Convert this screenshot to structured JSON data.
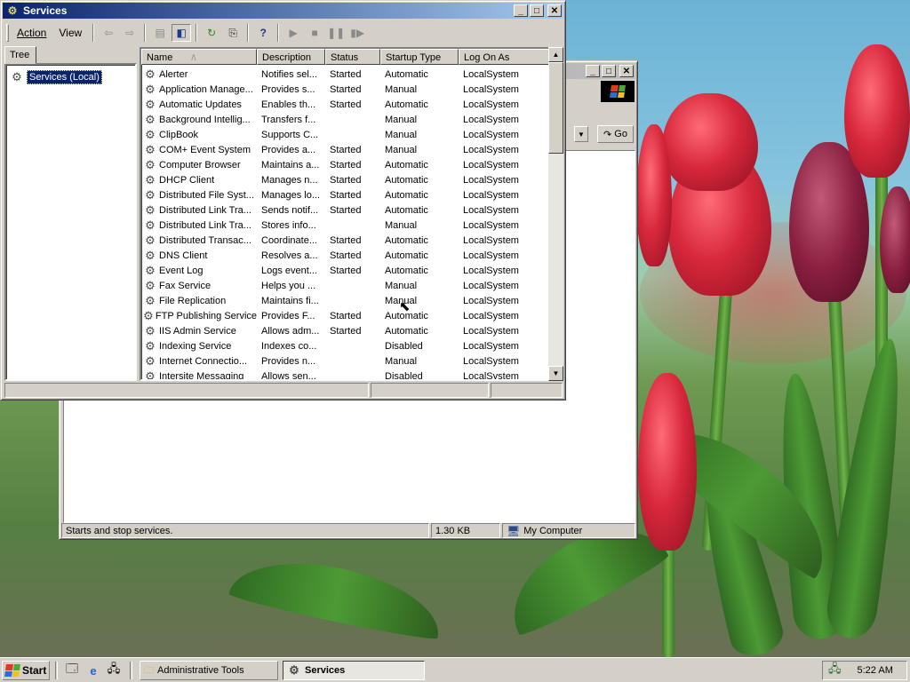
{
  "services_window": {
    "title": "Services",
    "menu": {
      "action": "Action",
      "view": "View"
    },
    "tree_tab": "Tree",
    "tree_root": "Services (Local)",
    "columns": [
      "Name",
      "Description",
      "Status",
      "Startup Type",
      "Log On As"
    ],
    "sort_indicator": "/\\",
    "rows": [
      [
        "Alerter",
        "Notifies sel...",
        "Started",
        "Automatic",
        "LocalSystem"
      ],
      [
        "Application Manage...",
        "Provides s...",
        "Started",
        "Manual",
        "LocalSystem"
      ],
      [
        "Automatic Updates",
        "Enables th...",
        "Started",
        "Automatic",
        "LocalSystem"
      ],
      [
        "Background Intellig...",
        "Transfers f...",
        "",
        "Manual",
        "LocalSystem"
      ],
      [
        "ClipBook",
        "Supports C...",
        "",
        "Manual",
        "LocalSystem"
      ],
      [
        "COM+ Event System",
        "Provides a...",
        "Started",
        "Manual",
        "LocalSystem"
      ],
      [
        "Computer Browser",
        "Maintains a...",
        "Started",
        "Automatic",
        "LocalSystem"
      ],
      [
        "DHCP Client",
        "Manages n...",
        "Started",
        "Automatic",
        "LocalSystem"
      ],
      [
        "Distributed File Syst...",
        "Manages lo...",
        "Started",
        "Automatic",
        "LocalSystem"
      ],
      [
        "Distributed Link Tra...",
        "Sends notif...",
        "Started",
        "Automatic",
        "LocalSystem"
      ],
      [
        "Distributed Link Tra...",
        "Stores info...",
        "",
        "Manual",
        "LocalSystem"
      ],
      [
        "Distributed Transac...",
        "Coordinate...",
        "Started",
        "Automatic",
        "LocalSystem"
      ],
      [
        "DNS Client",
        "Resolves a...",
        "Started",
        "Automatic",
        "LocalSystem"
      ],
      [
        "Event Log",
        "Logs event...",
        "Started",
        "Automatic",
        "LocalSystem"
      ],
      [
        "Fax Service",
        "Helps you ...",
        "",
        "Manual",
        "LocalSystem"
      ],
      [
        "File Replication",
        "Maintains fi...",
        "",
        "Manual",
        "LocalSystem"
      ],
      [
        "FTP Publishing Service",
        "Provides F...",
        "Started",
        "Automatic",
        "LocalSystem"
      ],
      [
        "IIS Admin Service",
        "Allows adm...",
        "Started",
        "Automatic",
        "LocalSystem"
      ],
      [
        "Indexing Service",
        "Indexes co...",
        "",
        "Disabled",
        "LocalSystem"
      ],
      [
        "Internet Connectio...",
        "Provides n...",
        "",
        "Manual",
        "LocalSystem"
      ],
      [
        "Intersite Messaging",
        "Allows sen...",
        "",
        "Disabled",
        "LocalSystem"
      ]
    ]
  },
  "admin_window": {
    "go_label": "Go",
    "status_text": "Starts and stop services.",
    "size": "1.30 KB",
    "zone": "My Computer"
  },
  "taskbar": {
    "start": "Start",
    "tasks": [
      "Administrative Tools",
      "Services"
    ],
    "clock": "5:22 AM"
  },
  "colors": {
    "title_active": "#0a246a",
    "title_gradient_end": "#a6caf0",
    "face": "#d4d0c8",
    "selection": "#0a246a"
  },
  "icons": {
    "service": "gear-icon",
    "back": "back-arrow-icon",
    "forward": "forward-arrow-icon",
    "up": "folder-up-icon",
    "show_tree": "show-hide-tree-icon",
    "refresh": "refresh-icon",
    "export": "export-list-icon",
    "help": "help-icon",
    "play": "start-service-icon",
    "stop": "stop-service-icon",
    "pause": "pause-service-icon",
    "restart": "restart-service-icon"
  }
}
